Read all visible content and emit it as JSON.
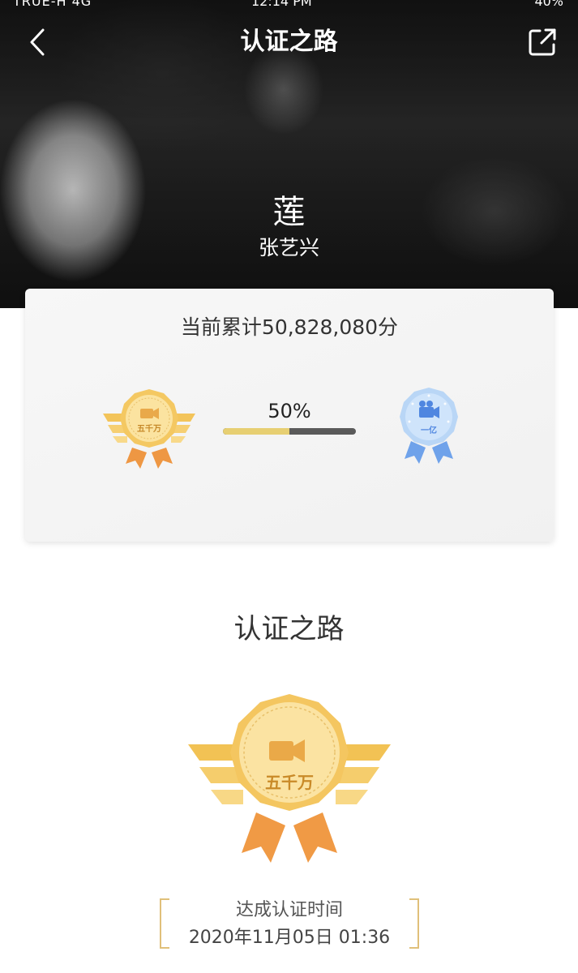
{
  "status_bar": {
    "carrier": "TRUE-H 4G",
    "time": "12:14 PM",
    "battery": "40%"
  },
  "nav": {
    "title": "认证之路",
    "back_icon": "chevron-left-icon",
    "share_icon": "share-external-icon"
  },
  "hero": {
    "work_title": "莲",
    "artist_name": "张艺兴"
  },
  "progress_card": {
    "score_text": "当前累计50,828,080分",
    "progress_percent_text": "50%",
    "progress_fraction": 0.5,
    "current_badge_label": "五千万",
    "next_badge_label": "一亿"
  },
  "section": {
    "title": "认证之路",
    "badge_label": "五千万"
  },
  "achievement": {
    "time_label": "达成认证时间",
    "time_value": "2020年11月05日 01:36"
  },
  "colors": {
    "gold": "#f3c75f",
    "gold_light": "#fbe6a7",
    "orange_ribbon": "#f09a45",
    "blue_badge": "#a9cdf5",
    "blue_icon": "#4f86e0",
    "progress_fill": "#e7cf72",
    "progress_track": "#5a5a5a"
  }
}
